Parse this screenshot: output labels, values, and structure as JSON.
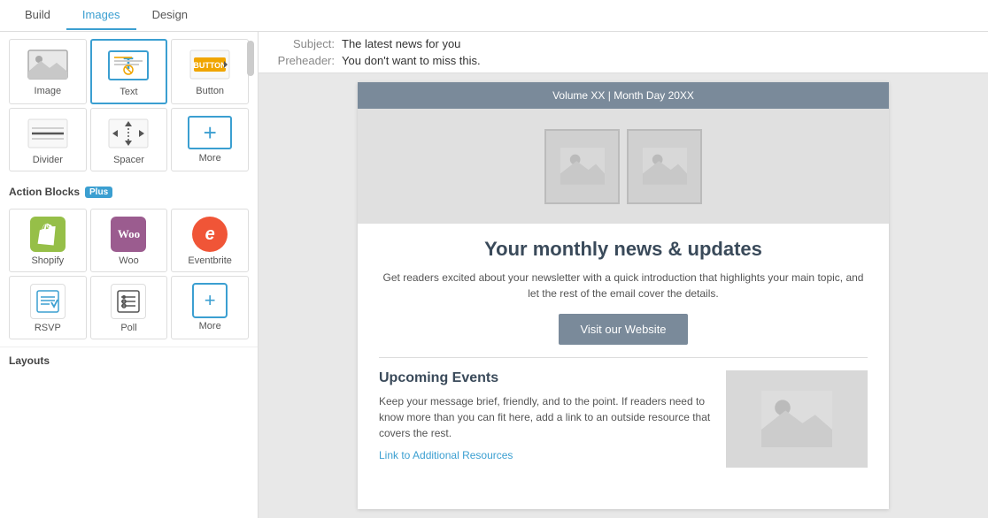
{
  "tabs": {
    "build": "Build",
    "images": "Images",
    "design": "Design",
    "active": "images"
  },
  "left_panel": {
    "content_blocks": [
      {
        "id": "image",
        "label": "Image"
      },
      {
        "id": "text",
        "label": "Text"
      },
      {
        "id": "button",
        "label": "Button"
      },
      {
        "id": "divider",
        "label": "Divider"
      },
      {
        "id": "spacer",
        "label": "Spacer"
      },
      {
        "id": "more",
        "label": "More"
      }
    ],
    "action_blocks_label": "Action Blocks",
    "plus_label": "Plus",
    "action_blocks": [
      {
        "id": "shopify",
        "label": "Shopify"
      },
      {
        "id": "woo",
        "label": "Woo"
      },
      {
        "id": "eventbrite",
        "label": "Eventbrite"
      },
      {
        "id": "rsvp",
        "label": "RSVP"
      },
      {
        "id": "poll",
        "label": "Poll"
      },
      {
        "id": "more-action",
        "label": "More"
      }
    ],
    "layouts_label": "Layouts"
  },
  "email_meta": {
    "subject_label": "Subject:",
    "subject_value": "The latest news for you",
    "preheader_label": "Preheader:",
    "preheader_value": "You don't want to miss this."
  },
  "email_preview": {
    "volume_line": "Volume XX | Month Day 20XX",
    "headline": "Your monthly news & updates",
    "body_text": "Get readers excited about your newsletter with a quick introduction that highlights your main topic, and let the rest of the email cover the details.",
    "cta_button": "Visit our Website",
    "upcoming_title": "Upcoming Events",
    "upcoming_text": "Keep your message brief, friendly, and to the point. If readers need to know more than you can fit here, add a link to an outside resource that covers the rest.",
    "link_text": "Link to Additional Resources"
  }
}
